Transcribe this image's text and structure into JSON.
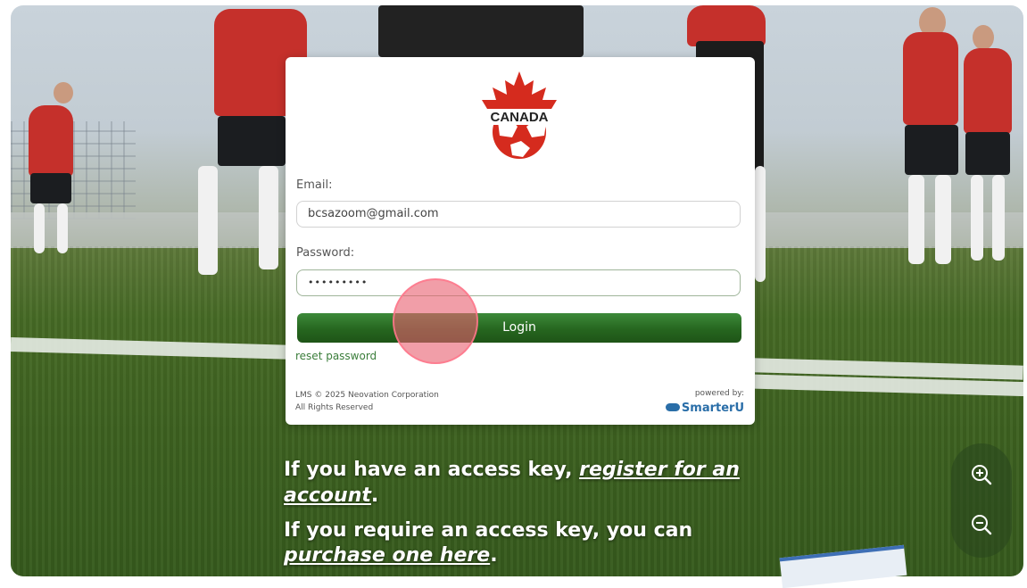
{
  "logo": {
    "text": "CANADA",
    "colors": {
      "red": "#d52b1e",
      "white": "#ffffff"
    }
  },
  "form": {
    "email_label": "Email:",
    "email_value": "bcsazoom@gmail.com",
    "password_label": "Password:",
    "password_value": "•••••••••",
    "login_label": "Login",
    "reset_label": "reset password"
  },
  "footer": {
    "copyright_line1": "LMS © 2025 Neovation Corporation",
    "copyright_line2": "All Rights Reserved",
    "powered_by": "powered by:",
    "brand": "SmarterU"
  },
  "access": {
    "line1_prefix": "If you have an access key, ",
    "register_link_part1": "register for an",
    "register_link_part2": "account",
    "line1_suffix": ".",
    "line2_prefix": "If you require an access key, you can",
    "purchase_link": "purchase one here",
    "line2_suffix": "."
  },
  "zoom": {
    "in_icon": "zoom-in-icon",
    "out_icon": "zoom-out-icon"
  },
  "accent": {
    "green": "#26661f",
    "link_blue": "#2a6ea8"
  }
}
